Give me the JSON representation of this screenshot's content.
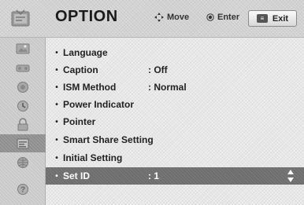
{
  "header": {
    "title": "OPTION",
    "icon": "option-menu-icon",
    "hints": {
      "move": "Move",
      "enter": "Enter",
      "exit": "Exit"
    }
  },
  "sidebar": {
    "items": [
      {
        "icon": "picture-icon"
      },
      {
        "icon": "audio-icon"
      },
      {
        "icon": "channel-icon"
      },
      {
        "icon": "time-icon"
      },
      {
        "icon": "lock-icon"
      },
      {
        "icon": "option-icon",
        "active": true
      },
      {
        "icon": "network-icon"
      },
      {
        "icon": "support-icon"
      }
    ]
  },
  "menu": {
    "items": [
      {
        "label": "Language",
        "value": ""
      },
      {
        "label": "Caption",
        "value": ": Off"
      },
      {
        "label": "ISM Method",
        "value": ": Normal"
      },
      {
        "label": "Power Indicator",
        "value": ""
      },
      {
        "label": "Pointer",
        "value": ""
      },
      {
        "label": "Smart Share Setting",
        "value": ""
      },
      {
        "label": "Initial Setting",
        "value": ""
      },
      {
        "label": "Set ID",
        "value": ": 1",
        "selected": true
      }
    ]
  },
  "colors": {
    "header_bg": "#d2d2d2",
    "sidebar_bg": "#c9c9c9",
    "content_bg": "#e6e6e6",
    "selected_bg": "#6e6e6e",
    "selected_text": "#ffffff"
  }
}
